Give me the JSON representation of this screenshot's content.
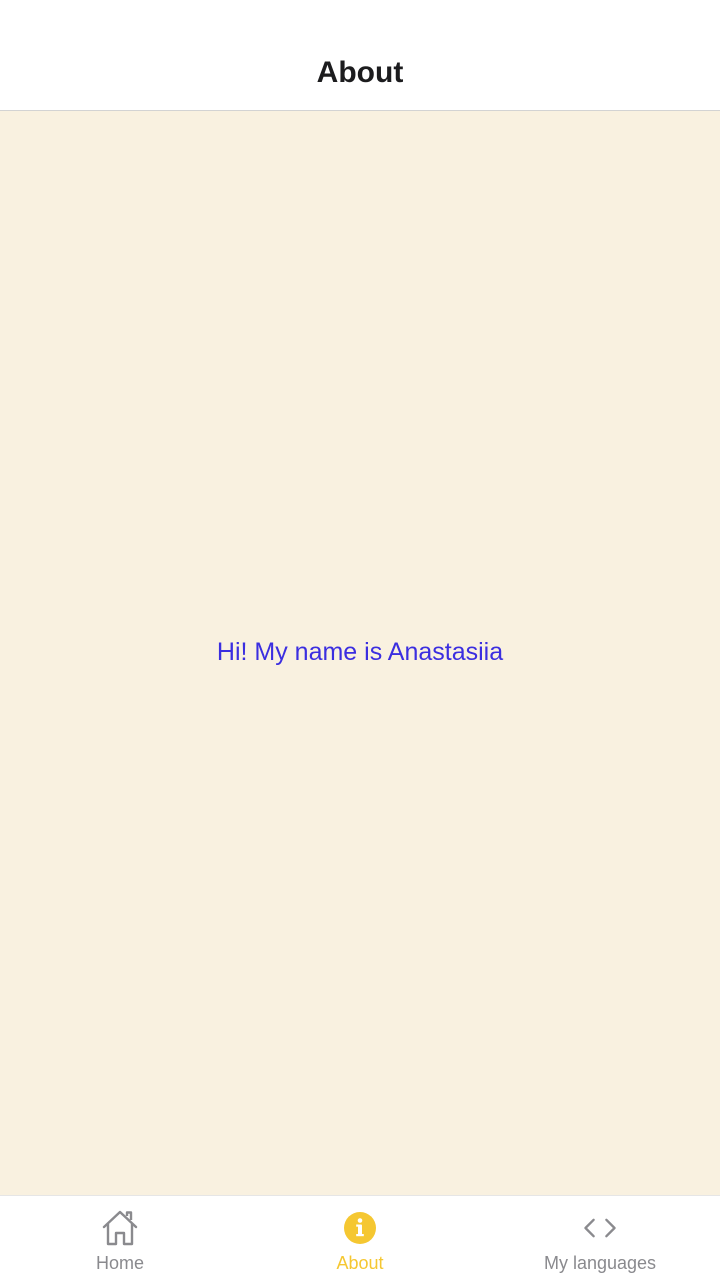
{
  "header": {
    "title": "About"
  },
  "main": {
    "greeting": "Hi! My name is Anastasiia"
  },
  "tabbar": {
    "tabs": [
      {
        "label": "Home",
        "icon": "home-icon",
        "active": false
      },
      {
        "label": "About",
        "icon": "info-icon",
        "active": true
      },
      {
        "label": "My languages",
        "icon": "code-icon",
        "active": false
      }
    ]
  },
  "colors": {
    "content_background": "#f9f1e0",
    "greeting_text": "#3b2ee0",
    "active_tab": "#f5c731",
    "inactive_tab": "#8a8a8e"
  }
}
